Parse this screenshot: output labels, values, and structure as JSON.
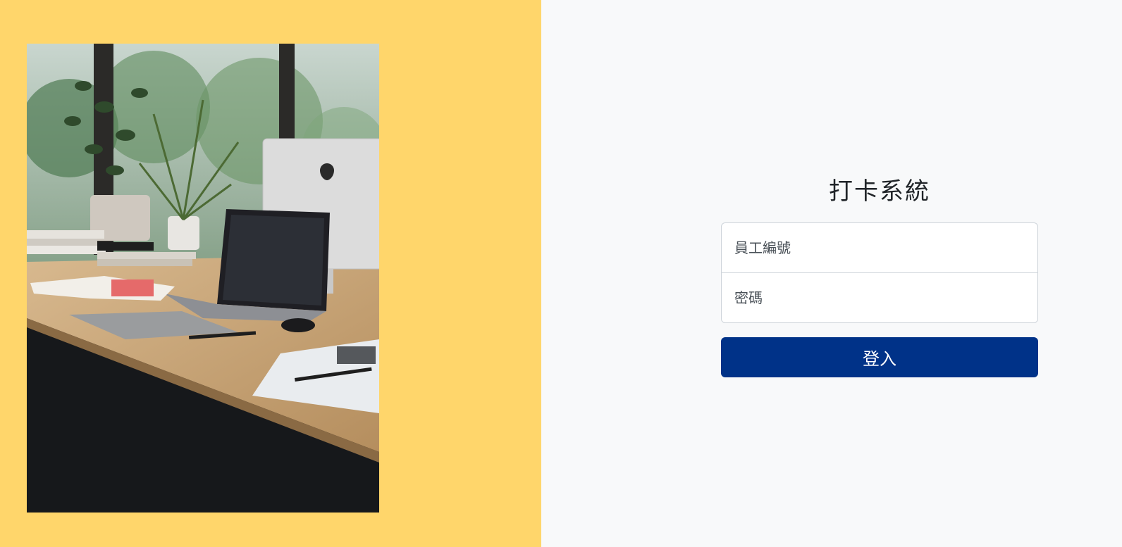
{
  "colors": {
    "left_background": "#ffd66b",
    "right_background": "#f8f9fa",
    "button_background": "#003288",
    "button_text": "#ffffff"
  },
  "login": {
    "title": "打卡系統",
    "employee_id_placeholder": "員工編號",
    "password_placeholder": "密碼",
    "submit_label": "登入"
  }
}
